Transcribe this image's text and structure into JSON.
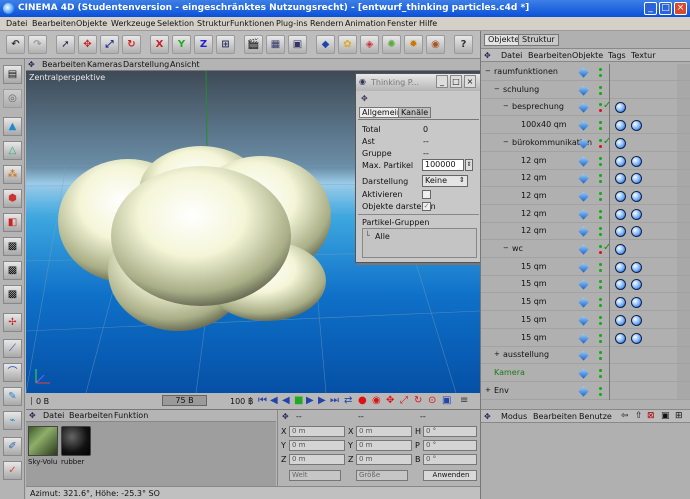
{
  "window": {
    "title": "CINEMA 4D (Studentenversion - eingeschränktes Nutzungsrecht) - [entwurf_thinking particles.c4d *]",
    "minimize": "_",
    "maximize": "□",
    "close": "×"
  },
  "menubar": [
    "Datei",
    "Bearbeiten",
    "Objekte",
    "Werkzeuge",
    "Selektion",
    "Struktur",
    "Funktionen",
    "Plug-ins",
    "Rendern",
    "Animation",
    "Fenster",
    "Hilfe"
  ],
  "toolbar": {
    "axis_x": "X",
    "axis_y": "Y",
    "axis_z": "Z"
  },
  "viewport": {
    "menu": [
      "Bearbeiten",
      "Kameras",
      "Darstellung",
      "Ansicht"
    ],
    "label": "Zentralperspektive"
  },
  "timeline": {
    "start": "0 B",
    "current": "75 B",
    "end": "100 B"
  },
  "materials": {
    "menu": [
      "Datei",
      "Bearbeiten",
      "Funktion"
    ],
    "items": [
      {
        "label": "Sky-Volu"
      },
      {
        "label": "rubber"
      }
    ]
  },
  "coordinates": {
    "header": [
      "--",
      "--",
      "--"
    ],
    "rows": [
      {
        "axis": "X",
        "pos": "0 m",
        "size_axis": "X",
        "size": "0 m",
        "rot_axis": "H",
        "rot": "0 °"
      },
      {
        "axis": "Y",
        "pos": "0 m",
        "size_axis": "Y",
        "size": "0 m",
        "rot_axis": "P",
        "rot": "0 °"
      },
      {
        "axis": "Z",
        "pos": "0 m",
        "size_axis": "Z",
        "size": "0 m",
        "rot_axis": "B",
        "rot": "0 °"
      }
    ],
    "mode_select": "Welt",
    "size_select": "Größe",
    "apply_label": "Anwenden"
  },
  "status": {
    "text": "Azimut: 321.6°, Höhe: -25.3°  SO"
  },
  "objects_panel": {
    "tabs": [
      "Objekte",
      "Struktur"
    ],
    "menu": [
      "Datei",
      "Bearbeiten",
      "Objekte",
      "Tags",
      "Textur"
    ],
    "rows": [
      {
        "name": "raumfunktionen",
        "depth": 0,
        "expander": "−"
      },
      {
        "name": "schulung",
        "depth": 1,
        "expander": "−"
      },
      {
        "name": "besprechung",
        "depth": 2,
        "expander": "−",
        "check": "✓"
      },
      {
        "name": "100x40 qm",
        "depth": 3,
        "expander": ""
      },
      {
        "name": "bürokommunikation",
        "depth": 2,
        "expander": "−",
        "check": "✓"
      },
      {
        "name": "12 qm",
        "depth": 3,
        "expander": ""
      },
      {
        "name": "12 qm",
        "depth": 3,
        "expander": ""
      },
      {
        "name": "12 qm",
        "depth": 3,
        "expander": ""
      },
      {
        "name": "12 qm",
        "depth": 3,
        "expander": ""
      },
      {
        "name": "12 qm",
        "depth": 3,
        "expander": ""
      },
      {
        "name": "wc",
        "depth": 2,
        "expander": "−",
        "check": "✓"
      },
      {
        "name": "15 qm",
        "depth": 3,
        "expander": ""
      },
      {
        "name": "15 qm",
        "depth": 3,
        "expander": ""
      },
      {
        "name": "15 qm",
        "depth": 3,
        "expander": ""
      },
      {
        "name": "15 qm",
        "depth": 3,
        "expander": ""
      },
      {
        "name": "15 qm",
        "depth": 3,
        "expander": ""
      },
      {
        "name": "ausstellung",
        "depth": 1,
        "expander": "+"
      },
      {
        "name": "Kamera",
        "depth": 0,
        "expander": ""
      },
      {
        "name": "Env",
        "depth": 0,
        "expander": "+"
      }
    ]
  },
  "attributes_panel": {
    "menu": [
      "Modus",
      "Bearbeiten",
      "Benutze"
    ]
  },
  "tp_dialog": {
    "title": "Thinking P...",
    "tabs": [
      "Allgemein",
      "Kanäle"
    ],
    "fields": {
      "total_label": "Total",
      "total_value": "0",
      "ast_label": "Ast",
      "ast_value": "--",
      "gruppe_label": "Gruppe",
      "gruppe_value": "--",
      "max_label": "Max. Partikel",
      "max_value": "100000",
      "darstellung_label": "Darstellung",
      "darstellung_value": "Keine",
      "aktivieren_label": "Aktivieren",
      "objekte_label": "Objekte darstellen"
    },
    "groups_header": "Partikel-Gruppen",
    "group_item": "Alle"
  }
}
